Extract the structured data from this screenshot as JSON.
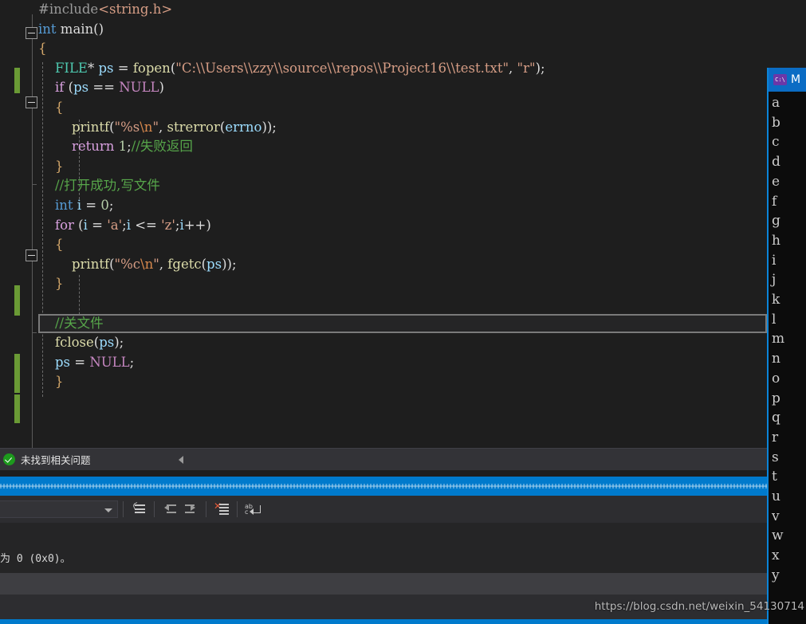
{
  "editor": {
    "language": "C",
    "theme_background": "#1e1e1e",
    "lines": [
      {
        "indent": 0,
        "tokens": [
          {
            "t": "#include",
            "c": "c-pp"
          },
          {
            "t": "<string.h>",
            "c": "c-hdr"
          }
        ]
      },
      {
        "indent": 0,
        "tokens": [
          {
            "t": "int",
            "c": "c-kw"
          },
          {
            "t": " main()",
            "c": "c-plain"
          }
        ]
      },
      {
        "indent": 0,
        "tokens": [
          {
            "t": "{",
            "c": "c-brace"
          }
        ]
      },
      {
        "indent": 1,
        "tokens": [
          {
            "t": "FILE",
            "c": "c-type"
          },
          {
            "t": "* ",
            "c": "c-plain"
          },
          {
            "t": "ps",
            "c": "c-var"
          },
          {
            "t": " = ",
            "c": "c-plain"
          },
          {
            "t": "fopen",
            "c": "c-fn"
          },
          {
            "t": "(",
            "c": "c-plain"
          },
          {
            "t": "\"C:\\\\Users\\\\zzy\\\\source\\\\repos\\\\Project16\\\\test.txt\"",
            "c": "c-str"
          },
          {
            "t": ", ",
            "c": "c-plain"
          },
          {
            "t": "\"r\"",
            "c": "c-str"
          },
          {
            "t": ");",
            "c": "c-plain"
          }
        ]
      },
      {
        "indent": 1,
        "tokens": [
          {
            "t": "if",
            "c": "c-ctrl"
          },
          {
            "t": " (",
            "c": "c-plain"
          },
          {
            "t": "ps",
            "c": "c-var"
          },
          {
            "t": " == ",
            "c": "c-plain"
          },
          {
            "t": "NULL",
            "c": "c-macro"
          },
          {
            "t": ")",
            "c": "c-plain"
          }
        ]
      },
      {
        "indent": 1,
        "tokens": [
          {
            "t": "{",
            "c": "c-brace"
          }
        ]
      },
      {
        "indent": 2,
        "tokens": [
          {
            "t": "printf",
            "c": "c-fn"
          },
          {
            "t": "(",
            "c": "c-plain"
          },
          {
            "t": "\"%s",
            "c": "c-str"
          },
          {
            "t": "\\n",
            "c": "c-esc"
          },
          {
            "t": "\"",
            "c": "c-str"
          },
          {
            "t": ", ",
            "c": "c-plain"
          },
          {
            "t": "strerror",
            "c": "c-fn"
          },
          {
            "t": "(",
            "c": "c-plain"
          },
          {
            "t": "errno",
            "c": "c-var"
          },
          {
            "t": "));",
            "c": "c-plain"
          }
        ]
      },
      {
        "indent": 2,
        "tokens": [
          {
            "t": "return",
            "c": "c-ctrl"
          },
          {
            "t": " ",
            "c": "c-plain"
          },
          {
            "t": "1",
            "c": "c-num"
          },
          {
            "t": ";",
            "c": "c-plain"
          },
          {
            "t": "//失败返回",
            "c": "c-cmt"
          }
        ]
      },
      {
        "indent": 1,
        "tokens": [
          {
            "t": "}",
            "c": "c-brace"
          }
        ]
      },
      {
        "indent": 1,
        "tokens": [
          {
            "t": "//打开成功,写文件",
            "c": "c-cmt"
          }
        ]
      },
      {
        "indent": 1,
        "tokens": [
          {
            "t": "int",
            "c": "c-kw"
          },
          {
            "t": " ",
            "c": "c-plain"
          },
          {
            "t": "i",
            "c": "c-var"
          },
          {
            "t": " = ",
            "c": "c-plain"
          },
          {
            "t": "0",
            "c": "c-num"
          },
          {
            "t": ";",
            "c": "c-plain"
          }
        ]
      },
      {
        "indent": 1,
        "tokens": [
          {
            "t": "for",
            "c": "c-ctrl"
          },
          {
            "t": " (",
            "c": "c-plain"
          },
          {
            "t": "i",
            "c": "c-var"
          },
          {
            "t": " = ",
            "c": "c-plain"
          },
          {
            "t": "'a'",
            "c": "c-str"
          },
          {
            "t": ";",
            "c": "c-plain"
          },
          {
            "t": "i",
            "c": "c-var"
          },
          {
            "t": " <= ",
            "c": "c-plain"
          },
          {
            "t": "'z'",
            "c": "c-str"
          },
          {
            "t": ";",
            "c": "c-plain"
          },
          {
            "t": "i",
            "c": "c-var"
          },
          {
            "t": "++)",
            "c": "c-plain"
          }
        ]
      },
      {
        "indent": 1,
        "tokens": [
          {
            "t": "{",
            "c": "c-brace"
          }
        ]
      },
      {
        "indent": 2,
        "tokens": [
          {
            "t": "printf",
            "c": "c-fn"
          },
          {
            "t": "(",
            "c": "c-plain"
          },
          {
            "t": "\"%c",
            "c": "c-str"
          },
          {
            "t": "\\n",
            "c": "c-esc"
          },
          {
            "t": "\"",
            "c": "c-str"
          },
          {
            "t": ", ",
            "c": "c-plain"
          },
          {
            "t": "fgetc",
            "c": "c-fn"
          },
          {
            "t": "(",
            "c": "c-plain"
          },
          {
            "t": "ps",
            "c": "c-var"
          },
          {
            "t": "));",
            "c": "c-plain"
          }
        ]
      },
      {
        "indent": 1,
        "tokens": [
          {
            "t": "}",
            "c": "c-brace"
          }
        ]
      },
      {
        "indent": 0,
        "tokens": []
      },
      {
        "indent": 1,
        "current": true,
        "tokens": [
          {
            "t": "//关文件",
            "c": "c-cmt"
          }
        ]
      },
      {
        "indent": 1,
        "tokens": [
          {
            "t": "fclose",
            "c": "c-fn"
          },
          {
            "t": "(",
            "c": "c-plain"
          },
          {
            "t": "ps",
            "c": "c-var"
          },
          {
            "t": ");",
            "c": "c-plain"
          }
        ]
      },
      {
        "indent": 1,
        "tokens": [
          {
            "t": "ps",
            "c": "c-var"
          },
          {
            "t": " = ",
            "c": "c-plain"
          },
          {
            "t": "NULL",
            "c": "c-macro"
          },
          {
            "t": ";",
            "c": "c-plain"
          }
        ]
      },
      {
        "indent": 1,
        "tokens": [
          {
            "t": "}",
            "c": "c-brace"
          }
        ]
      }
    ]
  },
  "error_strip": {
    "status_text": "未找到相关问题",
    "status_icon": "check-circle-icon",
    "ok_color": "#1d9a1d"
  },
  "blue_bar": {
    "color": "#007acc"
  },
  "toolbar": {
    "combo_value": "",
    "buttons": [
      {
        "name": "undo-list-icon",
        "title": ""
      },
      {
        "name": "outdent-icon",
        "title": ""
      },
      {
        "name": "indent-icon",
        "title": ""
      },
      {
        "name": "clear-all-icon",
        "title": ""
      },
      {
        "name": "word-wrap-icon",
        "title": ""
      }
    ]
  },
  "output": {
    "text": "为 0 (0x0)。"
  },
  "console": {
    "title": "M",
    "icon": "cmd-icon",
    "title_bar_color": "#0b6cc4",
    "border_color": "#0b84d8",
    "lines": [
      "a",
      "b",
      "c",
      "d",
      "e",
      "f",
      "g",
      "h",
      "i",
      "j",
      "k",
      "l",
      "m",
      "n",
      "o",
      "p",
      "q",
      "r",
      "s",
      "t",
      "u",
      "v",
      "w",
      "x",
      "y"
    ]
  },
  "watermark": {
    "text": "https://blog.csdn.net/weixin_54130714"
  }
}
